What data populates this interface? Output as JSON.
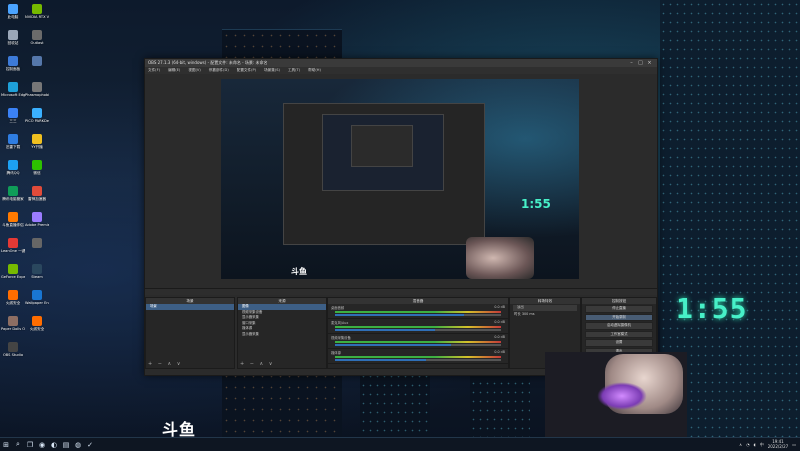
{
  "desktop": {
    "icons": [
      {
        "label": "此电脑",
        "color": "#4aa3ff"
      },
      {
        "label": "NVIDIA RTX Voice",
        "color": "#76b900"
      },
      {
        "label": "回收站",
        "color": "#9aa7b8"
      },
      {
        "label": "Outlast",
        "color": "#6b6b6b"
      },
      {
        "label": "控制面板",
        "color": "#3d7bd9"
      },
      {
        "label": "",
        "color": "#5577aa"
      },
      {
        "label": "Microsoft Edge",
        "color": "#1ea0d8"
      },
      {
        "label": "Phasmophobia",
        "color": "#777777"
      },
      {
        "label": "三三",
        "color": "#3b82f6"
      },
      {
        "label": "PICO PARKDemo",
        "color": "#3ab0ff"
      },
      {
        "label": "迅雷下载",
        "color": "#2f7de1"
      },
      {
        "label": "YY开播",
        "color": "#f0c020"
      },
      {
        "label": "腾讯QQ",
        "color": "#1da1f2"
      },
      {
        "label": "微信",
        "color": "#2dc100"
      },
      {
        "label": "腾讯电脑管家",
        "color": "#0f9d58"
      },
      {
        "label": "雷神加速器",
        "color": "#e04b3a"
      },
      {
        "label": "斗鱼直播伴侣",
        "color": "#ff7a00"
      },
      {
        "label": "Adobe Premie...",
        "color": "#9b7cff"
      },
      {
        "label": "LeanOne 一键办公",
        "color": "#e53935"
      },
      {
        "label": "",
        "color": "#666666"
      },
      {
        "label": "GeForce Experience",
        "color": "#76b900"
      },
      {
        "label": "Steam",
        "color": "#2a475e"
      },
      {
        "label": "火绒安全",
        "color": "#ff6d00"
      },
      {
        "label": "Wallpaper Engine",
        "color": "#1976d2"
      },
      {
        "label": "Paper Dolls Original",
        "color": "#8d6e63"
      },
      {
        "label": "火绒安全",
        "color": "#ff6d00"
      },
      {
        "label": "OBS Studio",
        "color": "#444444"
      }
    ],
    "wall_clock": "1:55",
    "logo": "斗鱼"
  },
  "obs": {
    "title": "OBS 27.1.3 (64-bit, windows) - 配置文件: 未命名 - 场景: 未命名",
    "menu": [
      "文件(F)",
      "编辑(E)",
      "视图(V)",
      "停靠部件(D)",
      "配置文件(P)",
      "场景集(S)",
      "工具(T)",
      "帮助(H)"
    ],
    "preview_logo": "斗鱼",
    "preview_clock": "1:55",
    "dock_bar_label": "",
    "scenes": {
      "title": "场景",
      "items": [
        "场景"
      ]
    },
    "sources": {
      "title": "来源",
      "items": [
        "图像",
        "视频采集设备",
        "显示器采集",
        "窗口采集",
        "媒体源",
        "显示器采集"
      ]
    },
    "mixer": {
      "title": "混音器",
      "channels": [
        {
          "name": "桌面音频",
          "db": "0.0 dB",
          "level": 0.78
        },
        {
          "name": "麦克风/Aux",
          "db": "0.0 dB",
          "level": 0.6
        },
        {
          "name": "视频采集设备",
          "db": "0.0 dB",
          "level": 0.7
        },
        {
          "name": "媒体源",
          "db": "0.0 dB",
          "level": 0.55
        }
      ]
    },
    "transitions": {
      "title": "转场特效",
      "type": "淡出",
      "duration_label": "时长",
      "duration": "300 ms"
    },
    "controls": {
      "title": "控制按钮",
      "buttons": [
        "停止直播",
        "开始录制",
        "启动虚拟摄像机",
        "工作室模式",
        "设置",
        "退出"
      ]
    },
    "dock_footer": "+ − ∧ ∨"
  },
  "taskbar": {
    "time": "19:41",
    "date": "2022/2/27",
    "lang": "中",
    "pinned": [
      "windows-icon",
      "search-icon",
      "task-view-icon",
      "obs-icon",
      "edge-icon",
      "explorer-icon",
      "wechat-icon",
      "check-icon"
    ]
  }
}
